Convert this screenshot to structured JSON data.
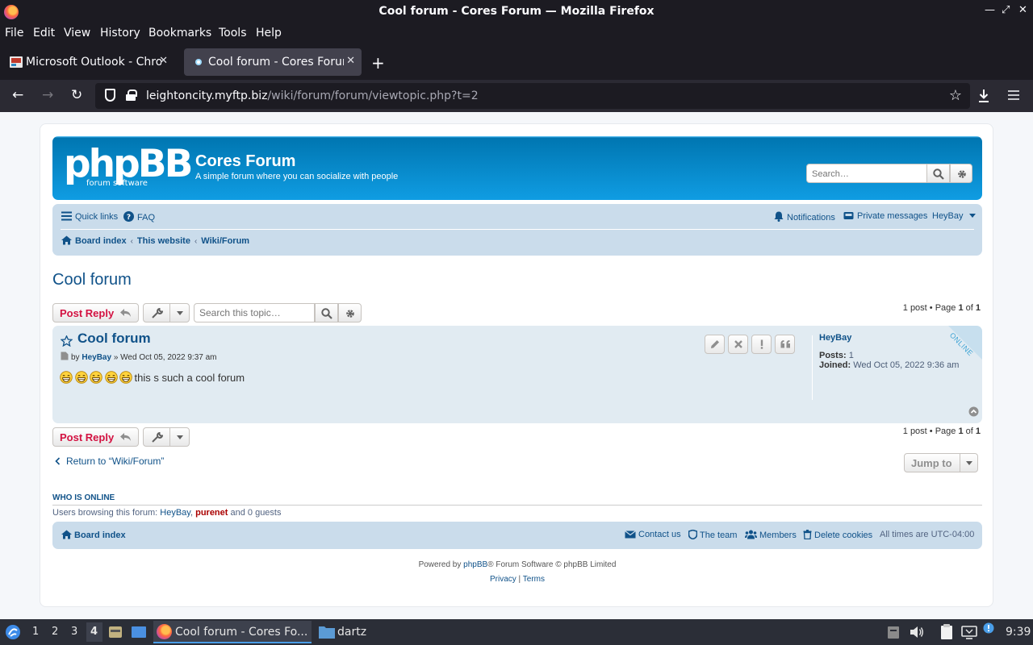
{
  "window": {
    "title": "Cool forum - Cores Forum — Mozilla Firefox"
  },
  "menu": [
    "File",
    "Edit",
    "View",
    "History",
    "Bookmarks",
    "Tools",
    "Help"
  ],
  "tabs": [
    {
      "title": "Microsoft Outlook - Chrome"
    },
    {
      "title": "Cool forum - Cores Forum"
    }
  ],
  "address": {
    "host": "leightoncity.myftp.biz",
    "path": "/wiki/forum/forum/viewtopic.php?t=2"
  },
  "forum": {
    "logo_text": "phpBB",
    "logo_sub": "forum  software",
    "name": "Cores Forum",
    "description": "A simple forum where you can socialize with people",
    "search_placeholder": "Search…"
  },
  "nav": {
    "quick_links": "Quick links",
    "faq": "FAQ",
    "notifications": "Notifications",
    "private_messages": "Private messages",
    "user": "HeyBay",
    "breadcrumbs": [
      "Board index",
      "This website",
      "Wiki/Forum"
    ]
  },
  "topic": {
    "title": "Cool forum",
    "post_reply": "Post Reply",
    "search_placeholder": "Search this topic…",
    "pagination": {
      "posts": "1 post • Page ",
      "page": "1",
      "of": " of ",
      "total": "1"
    }
  },
  "post": {
    "title": "Cool forum",
    "by": "by",
    "author": "HeyBay",
    "date": "» Wed Oct 05, 2022 9:37 am",
    "smiley_count": 5,
    "text": "this s such a cool forum",
    "profile": {
      "name": "HeyBay",
      "posts_label": "Posts:",
      "posts_value": "1",
      "joined_label": "Joined:",
      "joined_value": "Wed Oct 05, 2022 9:36 am",
      "status": "ONLINE"
    }
  },
  "after_post": {
    "return_link": "Return to “Wiki/Forum”",
    "jump_to": "Jump to"
  },
  "who_online": {
    "title": "WHO IS ONLINE",
    "prefix": "Users browsing this forum: ",
    "user1": "HeyBay",
    "separator": ", ",
    "user2": "purenet",
    "suffix": " and 0 guests"
  },
  "footer_nav": {
    "board_index": "Board index",
    "contact": "Contact us",
    "team": "The team",
    "members": "Members",
    "delete_cookies": "Delete cookies",
    "timezone": "All times are UTC-04:00"
  },
  "copyright": {
    "powered_prefix": "Powered by ",
    "phpbb": "phpBB",
    "powered_suffix": "® Forum Software © phpBB Limited",
    "privacy": "Privacy",
    "sep": " | ",
    "terms": "Terms"
  },
  "taskbar": {
    "workspaces": [
      "1",
      "2",
      "3",
      "4"
    ],
    "firefox_task": "Cool forum - Cores Fo...",
    "files_task": "dartz",
    "clock": "9:39"
  },
  "colors": {
    "header_gradient_top": "#0076b1",
    "header_gradient_bottom": "#12a3eb",
    "navbar_bg": "#cadceb",
    "post_bg": "#e1ebf2",
    "link": "#105289",
    "reply_button": "#d31141"
  }
}
